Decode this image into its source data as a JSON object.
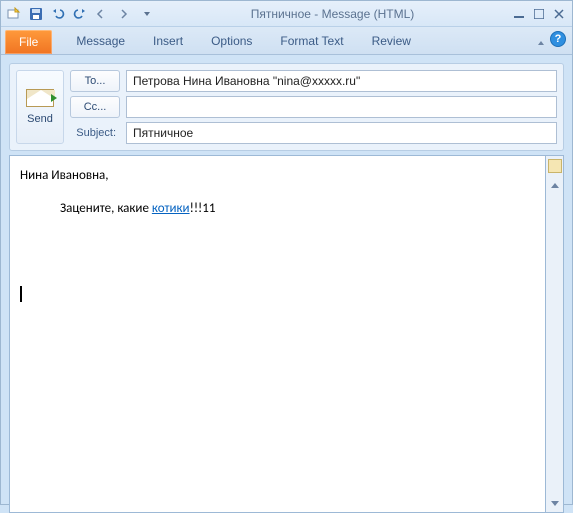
{
  "window": {
    "title": "Пятничное  -  Message (HTML)"
  },
  "ribbon": {
    "file": "File",
    "tabs": [
      "Message",
      "Insert",
      "Options",
      "Format Text",
      "Review"
    ]
  },
  "send": {
    "label": "Send"
  },
  "fields": {
    "to_btn": "To...",
    "cc_btn": "Cc...",
    "subject_label": "Subject:",
    "to_value": "Петрова Нина Ивановна \"nina@xxxxx.ru\"",
    "cc_value": "",
    "subject_value": "Пятничное"
  },
  "body": {
    "greeting": "Нина Ивановна,",
    "line_prefix": "Зацените, какие ",
    "link_text": "котики",
    "line_suffix": "!!!11"
  }
}
